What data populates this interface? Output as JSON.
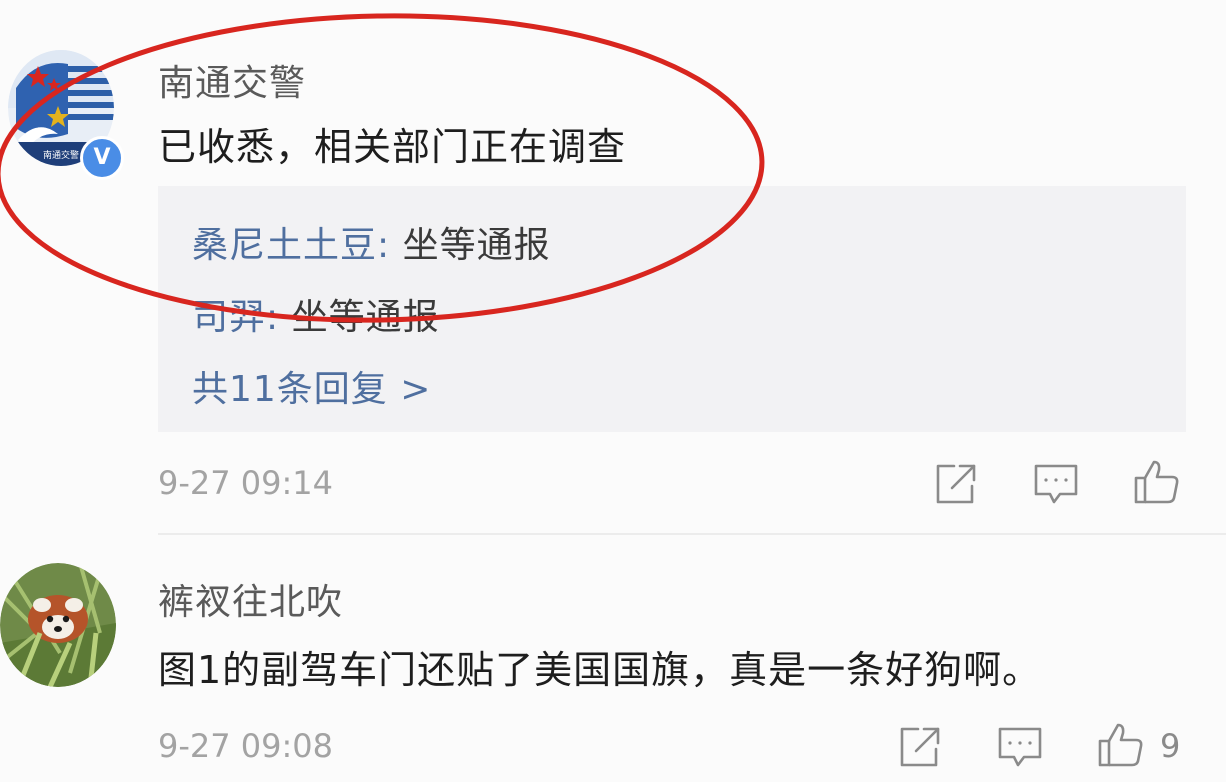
{
  "comments": [
    {
      "username": "南通交警",
      "content": "已收悉，相关部门正在调查",
      "verified_badge": "V",
      "avatar_icon": "police-emblem-avatar",
      "avatar_caption": "南通交警",
      "replies": [
        {
          "name": "桑尼土土豆",
          "sep": ": ",
          "text": "坐等通报"
        },
        {
          "name": "司羿",
          "sep": ": ",
          "text": "坐等通报"
        }
      ],
      "more_replies": "共11条回复 >",
      "time": "9-27 09:14",
      "actions": {
        "share_icon": "share-icon",
        "comment_icon": "comment-icon",
        "like_icon": "thumbs-up-icon",
        "like_count": ""
      }
    },
    {
      "username": "裤衩往北吹",
      "content": "图1的副驾车门还贴了美国国旗，真是一条好狗啊。",
      "avatar_icon": "red-panda-avatar",
      "time": "9-27 09:08",
      "actions": {
        "share_icon": "share-icon",
        "comment_icon": "comment-icon",
        "like_icon": "thumbs-up-icon",
        "like_count": "9"
      }
    }
  ],
  "colors": {
    "link": "#4f6f9f",
    "annotation": "#d8261f",
    "verified": "#4a8de6"
  }
}
